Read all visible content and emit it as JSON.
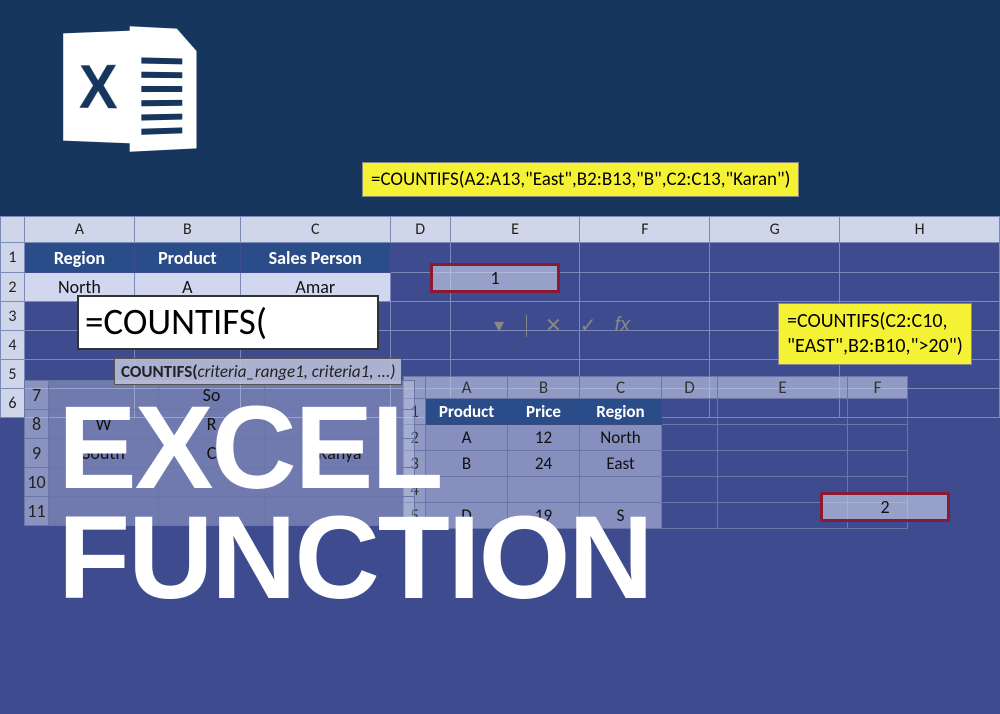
{
  "logo": {
    "x": "X"
  },
  "formula_main": "=COUNTIFS(A2:A13,\"East\",B2:B13,\"B\",C2:C13,\"Karan\")",
  "formula_secondary_l1": "=COUNTIFS(C2:C10,",
  "formula_secondary_l2": "\"EAST\",B2:B10,\">20\")",
  "sheet1": {
    "cols": [
      "A",
      "B",
      "C",
      "D",
      "E",
      "F",
      "G",
      "H"
    ],
    "headers": [
      "Region",
      "Product",
      "Sales Person"
    ],
    "row2": [
      "North",
      "A",
      "Amar"
    ],
    "rownums": [
      "1",
      "2",
      "3",
      "4",
      "5",
      "6"
    ]
  },
  "result1": "1",
  "editing": {
    "text": "=COUNTIFS(",
    "hint_fn": "COUNTIFS(",
    "hint_args": "criteria_range1, criteria1, ...)"
  },
  "sheet1_lower": {
    "rows": [
      {
        "n": "7",
        "c": [
          "",
          "So"
        ]
      },
      {
        "n": "8",
        "c": [
          "W",
          "R"
        ]
      },
      {
        "n": "9",
        "c": [
          "South",
          "C",
          "Ranya"
        ]
      },
      {
        "n": "10",
        "c": [
          "N",
          "",
          "S"
        ]
      },
      {
        "n": "11",
        "c": [
          "",
          "",
          ""
        ]
      }
    ]
  },
  "sheet2": {
    "cols": [
      "A",
      "B",
      "C",
      "D",
      "E",
      "F"
    ],
    "headers": [
      "Product",
      "Price",
      "Region"
    ],
    "rows": [
      {
        "n": "1"
      },
      {
        "n": "2",
        "c": [
          "A",
          "12",
          "North"
        ]
      },
      {
        "n": "3",
        "c": [
          "B",
          "24",
          "East"
        ]
      },
      {
        "n": "4",
        "c": [
          "",
          "",
          ""
        ]
      },
      {
        "n": "5",
        "c": [
          "D",
          "19",
          "S"
        ]
      }
    ]
  },
  "result2": "2",
  "fbar": {
    "x": "✕",
    "check": "✓",
    "fx": "fx",
    "dd": "▾"
  },
  "title": {
    "l1": "EXCEL",
    "l2": "FUNCTION"
  }
}
